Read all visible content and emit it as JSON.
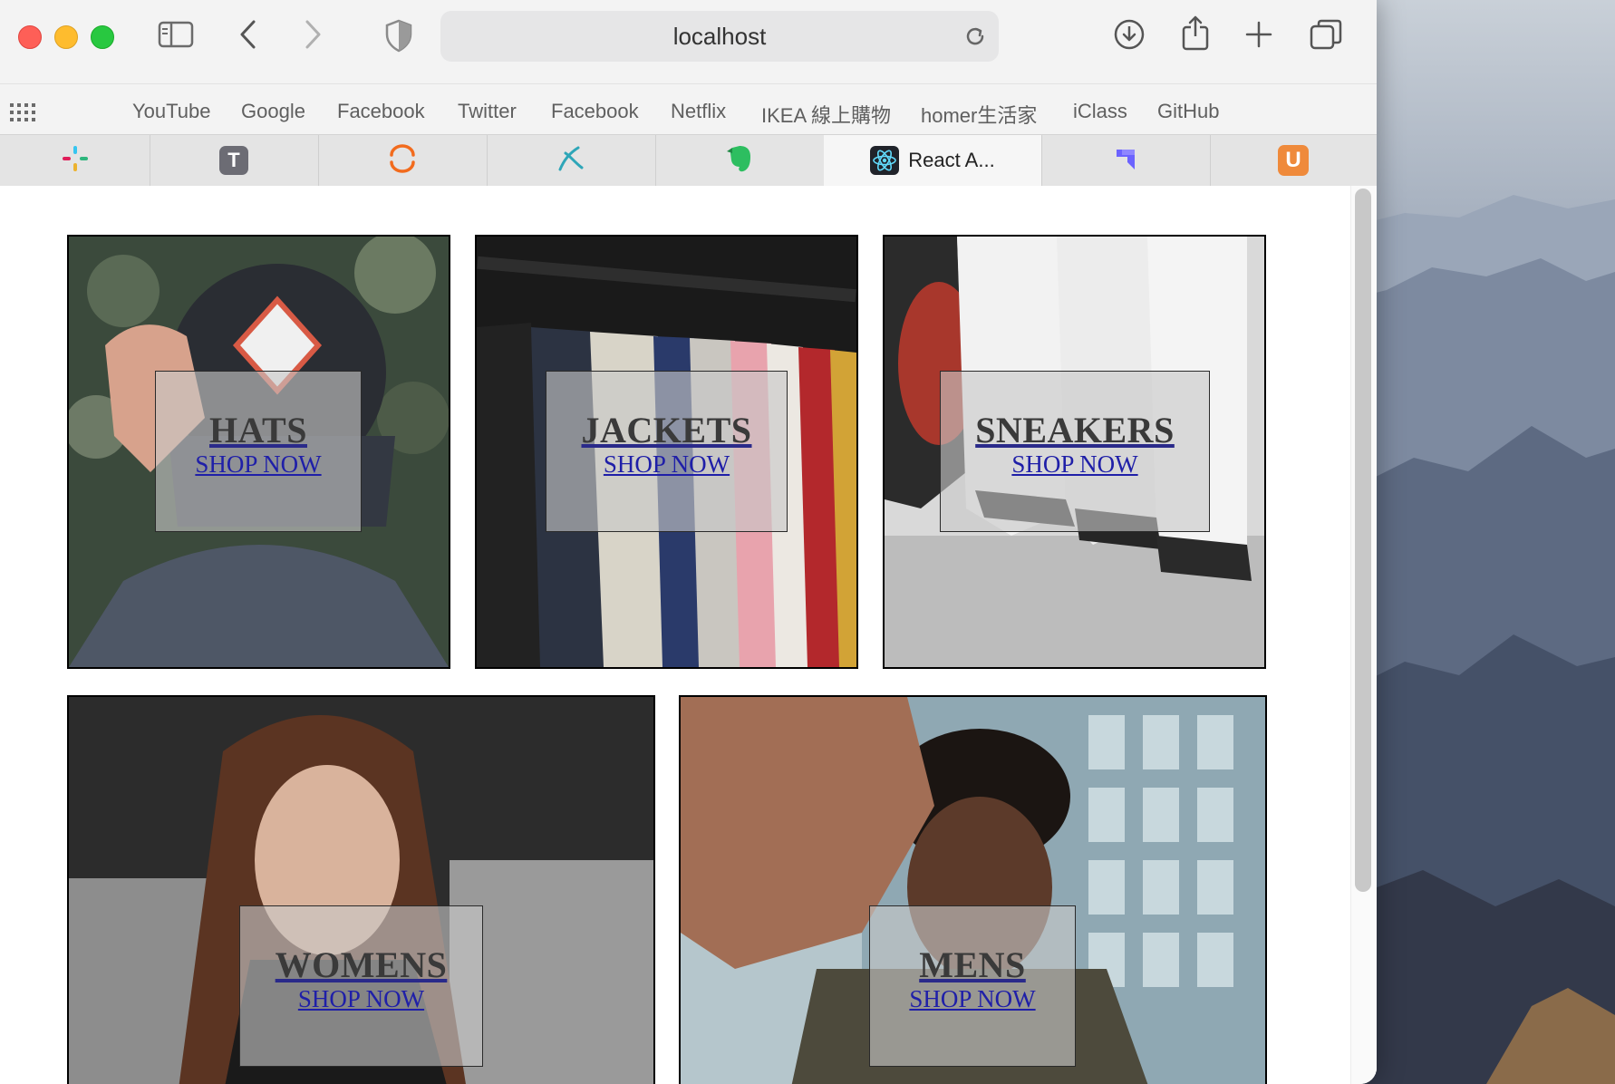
{
  "browser": {
    "url": "localhost",
    "favorites": [
      "YouTube",
      "Google",
      "Facebook",
      "Twitter",
      "Facebook",
      "Netflix",
      "IKEA 線上購物",
      "homer生活家",
      "iClass",
      "GitHub"
    ],
    "tabs": [
      {
        "icon": "slack-icon",
        "label": ""
      },
      {
        "icon": "typora-icon",
        "label": "",
        "glyph": "T"
      },
      {
        "icon": "orange-ring-icon",
        "label": ""
      },
      {
        "icon": "pen-tool-icon",
        "label": ""
      },
      {
        "icon": "evernote-icon",
        "label": ""
      },
      {
        "icon": "react-icon",
        "label": "React A..."
      },
      {
        "icon": "linear-app-icon",
        "label": ""
      },
      {
        "icon": "udemy-icon",
        "label": "",
        "glyph": "U"
      }
    ]
  },
  "directory": {
    "sections": [
      {
        "title": "HATS",
        "action": "SHOP NOW"
      },
      {
        "title": "JACKETS",
        "action": "SHOP NOW"
      },
      {
        "title": "SNEAKERS",
        "action": "SHOP NOW"
      },
      {
        "title": "WOMENS",
        "action": "SHOP NOW"
      },
      {
        "title": "MENS",
        "action": "SHOP NOW"
      }
    ]
  }
}
